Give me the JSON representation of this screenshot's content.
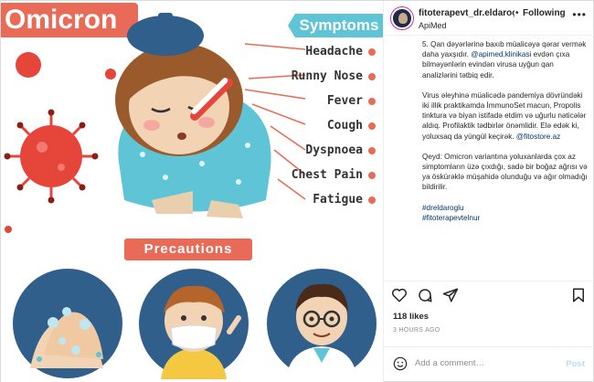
{
  "image": {
    "title": "Omicron",
    "symptoms_heading": "Symptoms",
    "symptoms": [
      "Headache",
      "Runny Nose",
      "Fever",
      "Cough",
      "Dyspnoea",
      "Chest Pain",
      "Fatigue"
    ],
    "precautions_heading": "Precautions"
  },
  "header": {
    "username": "fitoterapevt_dr.eldaroç",
    "separator": "•",
    "follow_label": "Following",
    "location": "ApiMed",
    "more_icon": "more-horizontal-icon"
  },
  "caption": {
    "paragraph1_before": "5. Qan dəyərlərinə baxıb müalicəyə qərar vermək daha yaxşıdır. ",
    "paragraph1_link": "@apimed.klinikasi",
    "paragraph1_after": " evdən çıxa bilməyənlərin evindən virusa uyğun qan analizlərini tətbiq edir.",
    "paragraph2": "Virus əleyhinə müalicədə pandemiya dövründəki iki illik praktikamda İmmunoSet macun, Propolis tinktura və biyan istifadə etdim və uğurlu nəticələr aldıq. Profilaktik tədbirlər önəmlidir. Elə edək ki, yoluxsaq da yüngül keçirək.",
    "paragraph2_link": "@fitostore.az",
    "paragraph3": "Qeyd: Omicron variantına yoluxanlarda çox az simptomların üzə çıxdığı, sadə bir boğaz ağrısı və ya öskürəklə müşahidə olunduğu və ağır olmadığı bildirilir.",
    "hashtags": [
      "#dreldaroglu",
      "#fitoterapevtelnur"
    ]
  },
  "actions": {
    "like_icon": "heart-icon",
    "comment_icon": "comment-icon",
    "share_icon": "send-icon",
    "save_icon": "bookmark-icon"
  },
  "stats": {
    "likes": "118 likes",
    "timestamp": "3 HOURS AGO"
  },
  "comment": {
    "placeholder": "Add a comment…",
    "post_label": "Post"
  },
  "colors": {
    "accent_red": "#e96a56",
    "accent_teal": "#5ec4d6",
    "link": "#00376b",
    "post_disabled": "#b2dffc"
  }
}
